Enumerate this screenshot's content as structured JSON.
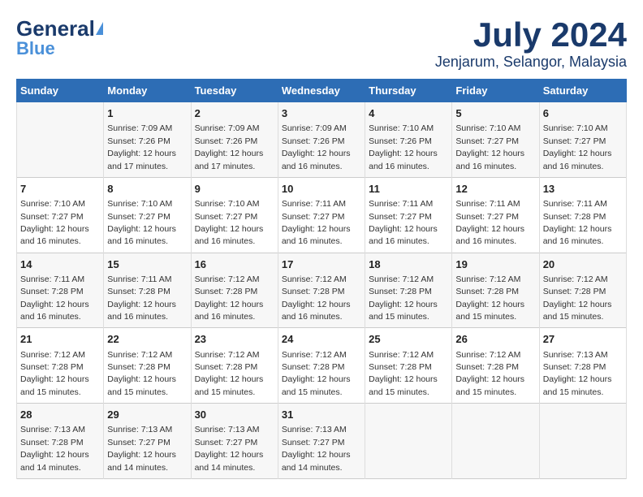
{
  "header": {
    "logo_general": "General",
    "logo_blue": "Blue",
    "month": "July 2024",
    "location": "Jenjarum, Selangor, Malaysia"
  },
  "days_of_week": [
    "Sunday",
    "Monday",
    "Tuesday",
    "Wednesday",
    "Thursday",
    "Friday",
    "Saturday"
  ],
  "weeks": [
    [
      {
        "date": "",
        "sunrise": "",
        "sunset": "",
        "daylight": ""
      },
      {
        "date": "1",
        "sunrise": "Sunrise: 7:09 AM",
        "sunset": "Sunset: 7:26 PM",
        "daylight": "Daylight: 12 hours and 17 minutes."
      },
      {
        "date": "2",
        "sunrise": "Sunrise: 7:09 AM",
        "sunset": "Sunset: 7:26 PM",
        "daylight": "Daylight: 12 hours and 17 minutes."
      },
      {
        "date": "3",
        "sunrise": "Sunrise: 7:09 AM",
        "sunset": "Sunset: 7:26 PM",
        "daylight": "Daylight: 12 hours and 16 minutes."
      },
      {
        "date": "4",
        "sunrise": "Sunrise: 7:10 AM",
        "sunset": "Sunset: 7:26 PM",
        "daylight": "Daylight: 12 hours and 16 minutes."
      },
      {
        "date": "5",
        "sunrise": "Sunrise: 7:10 AM",
        "sunset": "Sunset: 7:27 PM",
        "daylight": "Daylight: 12 hours and 16 minutes."
      },
      {
        "date": "6",
        "sunrise": "Sunrise: 7:10 AM",
        "sunset": "Sunset: 7:27 PM",
        "daylight": "Daylight: 12 hours and 16 minutes."
      }
    ],
    [
      {
        "date": "7",
        "sunrise": "Sunrise: 7:10 AM",
        "sunset": "Sunset: 7:27 PM",
        "daylight": "Daylight: 12 hours and 16 minutes."
      },
      {
        "date": "8",
        "sunrise": "Sunrise: 7:10 AM",
        "sunset": "Sunset: 7:27 PM",
        "daylight": "Daylight: 12 hours and 16 minutes."
      },
      {
        "date": "9",
        "sunrise": "Sunrise: 7:10 AM",
        "sunset": "Sunset: 7:27 PM",
        "daylight": "Daylight: 12 hours and 16 minutes."
      },
      {
        "date": "10",
        "sunrise": "Sunrise: 7:11 AM",
        "sunset": "Sunset: 7:27 PM",
        "daylight": "Daylight: 12 hours and 16 minutes."
      },
      {
        "date": "11",
        "sunrise": "Sunrise: 7:11 AM",
        "sunset": "Sunset: 7:27 PM",
        "daylight": "Daylight: 12 hours and 16 minutes."
      },
      {
        "date": "12",
        "sunrise": "Sunrise: 7:11 AM",
        "sunset": "Sunset: 7:27 PM",
        "daylight": "Daylight: 12 hours and 16 minutes."
      },
      {
        "date": "13",
        "sunrise": "Sunrise: 7:11 AM",
        "sunset": "Sunset: 7:28 PM",
        "daylight": "Daylight: 12 hours and 16 minutes."
      }
    ],
    [
      {
        "date": "14",
        "sunrise": "Sunrise: 7:11 AM",
        "sunset": "Sunset: 7:28 PM",
        "daylight": "Daylight: 12 hours and 16 minutes."
      },
      {
        "date": "15",
        "sunrise": "Sunrise: 7:11 AM",
        "sunset": "Sunset: 7:28 PM",
        "daylight": "Daylight: 12 hours and 16 minutes."
      },
      {
        "date": "16",
        "sunrise": "Sunrise: 7:12 AM",
        "sunset": "Sunset: 7:28 PM",
        "daylight": "Daylight: 12 hours and 16 minutes."
      },
      {
        "date": "17",
        "sunrise": "Sunrise: 7:12 AM",
        "sunset": "Sunset: 7:28 PM",
        "daylight": "Daylight: 12 hours and 16 minutes."
      },
      {
        "date": "18",
        "sunrise": "Sunrise: 7:12 AM",
        "sunset": "Sunset: 7:28 PM",
        "daylight": "Daylight: 12 hours and 15 minutes."
      },
      {
        "date": "19",
        "sunrise": "Sunrise: 7:12 AM",
        "sunset": "Sunset: 7:28 PM",
        "daylight": "Daylight: 12 hours and 15 minutes."
      },
      {
        "date": "20",
        "sunrise": "Sunrise: 7:12 AM",
        "sunset": "Sunset: 7:28 PM",
        "daylight": "Daylight: 12 hours and 15 minutes."
      }
    ],
    [
      {
        "date": "21",
        "sunrise": "Sunrise: 7:12 AM",
        "sunset": "Sunset: 7:28 PM",
        "daylight": "Daylight: 12 hours and 15 minutes."
      },
      {
        "date": "22",
        "sunrise": "Sunrise: 7:12 AM",
        "sunset": "Sunset: 7:28 PM",
        "daylight": "Daylight: 12 hours and 15 minutes."
      },
      {
        "date": "23",
        "sunrise": "Sunrise: 7:12 AM",
        "sunset": "Sunset: 7:28 PM",
        "daylight": "Daylight: 12 hours and 15 minutes."
      },
      {
        "date": "24",
        "sunrise": "Sunrise: 7:12 AM",
        "sunset": "Sunset: 7:28 PM",
        "daylight": "Daylight: 12 hours and 15 minutes."
      },
      {
        "date": "25",
        "sunrise": "Sunrise: 7:12 AM",
        "sunset": "Sunset: 7:28 PM",
        "daylight": "Daylight: 12 hours and 15 minutes."
      },
      {
        "date": "26",
        "sunrise": "Sunrise: 7:12 AM",
        "sunset": "Sunset: 7:28 PM",
        "daylight": "Daylight: 12 hours and 15 minutes."
      },
      {
        "date": "27",
        "sunrise": "Sunrise: 7:13 AM",
        "sunset": "Sunset: 7:28 PM",
        "daylight": "Daylight: 12 hours and 15 minutes."
      }
    ],
    [
      {
        "date": "28",
        "sunrise": "Sunrise: 7:13 AM",
        "sunset": "Sunset: 7:28 PM",
        "daylight": "Daylight: 12 hours and 14 minutes."
      },
      {
        "date": "29",
        "sunrise": "Sunrise: 7:13 AM",
        "sunset": "Sunset: 7:27 PM",
        "daylight": "Daylight: 12 hours and 14 minutes."
      },
      {
        "date": "30",
        "sunrise": "Sunrise: 7:13 AM",
        "sunset": "Sunset: 7:27 PM",
        "daylight": "Daylight: 12 hours and 14 minutes."
      },
      {
        "date": "31",
        "sunrise": "Sunrise: 7:13 AM",
        "sunset": "Sunset: 7:27 PM",
        "daylight": "Daylight: 12 hours and 14 minutes."
      },
      {
        "date": "",
        "sunrise": "",
        "sunset": "",
        "daylight": ""
      },
      {
        "date": "",
        "sunrise": "",
        "sunset": "",
        "daylight": ""
      },
      {
        "date": "",
        "sunrise": "",
        "sunset": "",
        "daylight": ""
      }
    ]
  ]
}
